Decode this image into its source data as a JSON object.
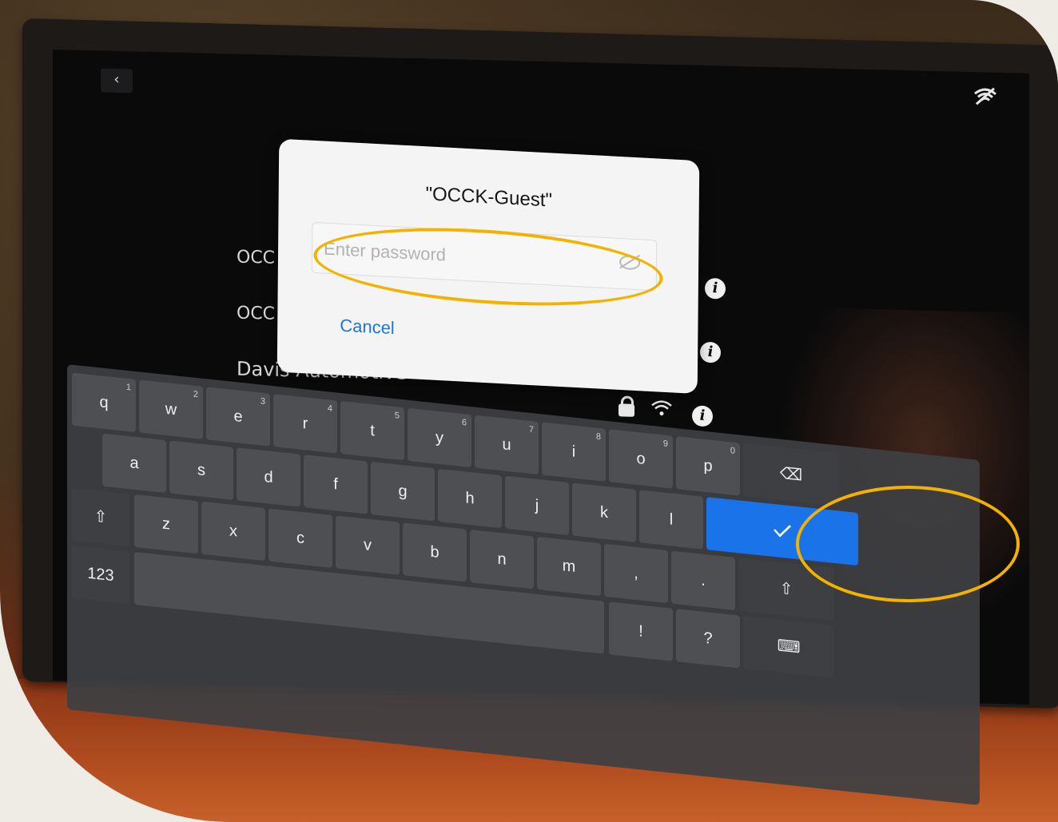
{
  "dialog": {
    "title": "\"OCCK-Guest\"",
    "password_placeholder": "Enter password",
    "cancel_label": "Cancel"
  },
  "networks": [
    {
      "label": "OCC"
    },
    {
      "label": "OCC"
    },
    {
      "label": "Davis Automotive"
    }
  ],
  "back_label": "‹",
  "keyboard": {
    "row1": [
      {
        "key": "q",
        "hint": "1"
      },
      {
        "key": "w",
        "hint": "2"
      },
      {
        "key": "e",
        "hint": "3"
      },
      {
        "key": "r",
        "hint": "4"
      },
      {
        "key": "t",
        "hint": "5"
      },
      {
        "key": "y",
        "hint": "6"
      },
      {
        "key": "u",
        "hint": "7"
      },
      {
        "key": "i",
        "hint": "8"
      },
      {
        "key": "o",
        "hint": "9"
      },
      {
        "key": "p",
        "hint": "0"
      }
    ],
    "row2": [
      "a",
      "s",
      "d",
      "f",
      "g",
      "h",
      "j",
      "k",
      "l"
    ],
    "row3": [
      "z",
      "x",
      "c",
      "v",
      "b",
      "n",
      "m",
      ",",
      "."
    ],
    "row4": [
      "!",
      "?"
    ],
    "shift_label": "⇧",
    "numbers_label": "123",
    "backspace_label": "⌫",
    "hide_label": "⌨"
  },
  "colors": {
    "highlight": "#f3b100",
    "done_key": "#1a73e8",
    "cancel_text": "#1d74d8"
  }
}
